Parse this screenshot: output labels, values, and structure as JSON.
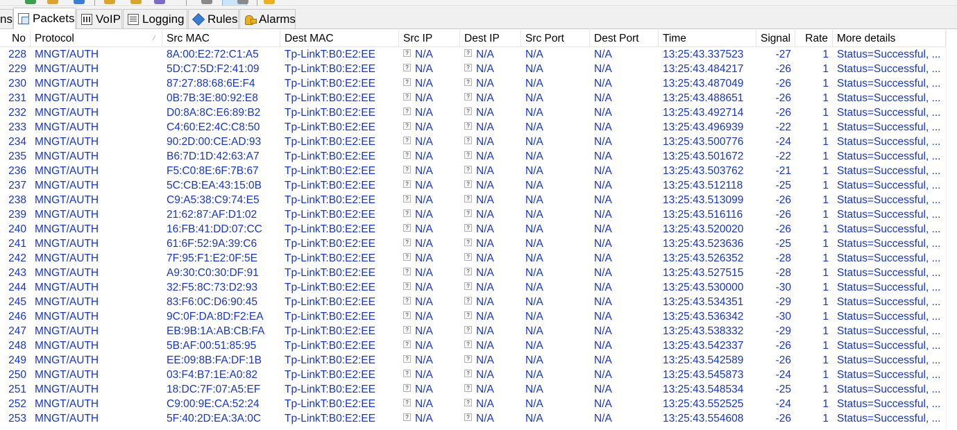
{
  "tabs": [
    {
      "label": "ns",
      "icon": "none",
      "active": false
    },
    {
      "label": "Packets",
      "icon": "packets-icon",
      "active": true
    },
    {
      "label": "VoIP",
      "icon": "voip-icon",
      "active": false
    },
    {
      "label": "Logging",
      "icon": "logging-icon",
      "active": false
    },
    {
      "label": "Rules",
      "icon": "rules-icon",
      "active": false
    },
    {
      "label": "Alarms",
      "icon": "alarms-icon",
      "active": false
    }
  ],
  "columns": {
    "no": "No",
    "protocol": "Protocol",
    "src_mac": "Src MAC",
    "dest_mac": "Dest MAC",
    "src_ip": "Src IP",
    "dest_ip": "Dest IP",
    "src_port": "Src Port",
    "dest_port": "Dest Port",
    "time": "Time",
    "signal": "Signal",
    "rate": "Rate",
    "details": "More details"
  },
  "colors": {
    "row_text": "#1434d4"
  },
  "rows": [
    {
      "no": "228",
      "protocol": "MNGT/AUTH",
      "src_mac": "8A:00:E2:72:C1:A5",
      "dest_mac": "Tp-LinkT:B0:E2:EE",
      "src_ip": "N/A",
      "dest_ip": "N/A",
      "src_port": "N/A",
      "dest_port": "N/A",
      "time": "13:25:43.337523",
      "signal": "-27",
      "rate": "1",
      "details": "Status=Successful, ..."
    },
    {
      "no": "229",
      "protocol": "MNGT/AUTH",
      "src_mac": "5D:C7:5D:F2:41:09",
      "dest_mac": "Tp-LinkT:B0:E2:EE",
      "src_ip": "N/A",
      "dest_ip": "N/A",
      "src_port": "N/A",
      "dest_port": "N/A",
      "time": "13:25:43.484217",
      "signal": "-26",
      "rate": "1",
      "details": "Status=Successful, ..."
    },
    {
      "no": "230",
      "protocol": "MNGT/AUTH",
      "src_mac": "87:27:88:68:6E:F4",
      "dest_mac": "Tp-LinkT:B0:E2:EE",
      "src_ip": "N/A",
      "dest_ip": "N/A",
      "src_port": "N/A",
      "dest_port": "N/A",
      "time": "13:25:43.487049",
      "signal": "-26",
      "rate": "1",
      "details": "Status=Successful, ..."
    },
    {
      "no": "231",
      "protocol": "MNGT/AUTH",
      "src_mac": "0B:7B:3E:80:92:E8",
      "dest_mac": "Tp-LinkT:B0:E2:EE",
      "src_ip": "N/A",
      "dest_ip": "N/A",
      "src_port": "N/A",
      "dest_port": "N/A",
      "time": "13:25:43.488651",
      "signal": "-26",
      "rate": "1",
      "details": "Status=Successful, ..."
    },
    {
      "no": "232",
      "protocol": "MNGT/AUTH",
      "src_mac": "D0:8A:8C:E6:89:B2",
      "dest_mac": "Tp-LinkT:B0:E2:EE",
      "src_ip": "N/A",
      "dest_ip": "N/A",
      "src_port": "N/A",
      "dest_port": "N/A",
      "time": "13:25:43.492714",
      "signal": "-26",
      "rate": "1",
      "details": "Status=Successful, ..."
    },
    {
      "no": "233",
      "protocol": "MNGT/AUTH",
      "src_mac": "C4:60:E2:4C:C8:50",
      "dest_mac": "Tp-LinkT:B0:E2:EE",
      "src_ip": "N/A",
      "dest_ip": "N/A",
      "src_port": "N/A",
      "dest_port": "N/A",
      "time": "13:25:43.496939",
      "signal": "-22",
      "rate": "1",
      "details": "Status=Successful, ..."
    },
    {
      "no": "234",
      "protocol": "MNGT/AUTH",
      "src_mac": "90:2D:00:CE:AD:93",
      "dest_mac": "Tp-LinkT:B0:E2:EE",
      "src_ip": "N/A",
      "dest_ip": "N/A",
      "src_port": "N/A",
      "dest_port": "N/A",
      "time": "13:25:43.500776",
      "signal": "-24",
      "rate": "1",
      "details": "Status=Successful, ..."
    },
    {
      "no": "235",
      "protocol": "MNGT/AUTH",
      "src_mac": "B6:7D:1D:42:63:A7",
      "dest_mac": "Tp-LinkT:B0:E2:EE",
      "src_ip": "N/A",
      "dest_ip": "N/A",
      "src_port": "N/A",
      "dest_port": "N/A",
      "time": "13:25:43.501672",
      "signal": "-22",
      "rate": "1",
      "details": "Status=Successful, ..."
    },
    {
      "no": "236",
      "protocol": "MNGT/AUTH",
      "src_mac": "F5:C0:8E:6F:7B:67",
      "dest_mac": "Tp-LinkT:B0:E2:EE",
      "src_ip": "N/A",
      "dest_ip": "N/A",
      "src_port": "N/A",
      "dest_port": "N/A",
      "time": "13:25:43.503762",
      "signal": "-21",
      "rate": "1",
      "details": "Status=Successful, ..."
    },
    {
      "no": "237",
      "protocol": "MNGT/AUTH",
      "src_mac": "5C:CB:EA:43:15:0B",
      "dest_mac": "Tp-LinkT:B0:E2:EE",
      "src_ip": "N/A",
      "dest_ip": "N/A",
      "src_port": "N/A",
      "dest_port": "N/A",
      "time": "13:25:43.512118",
      "signal": "-25",
      "rate": "1",
      "details": "Status=Successful, ..."
    },
    {
      "no": "238",
      "protocol": "MNGT/AUTH",
      "src_mac": "C9:A5:38:C9:74:E5",
      "dest_mac": "Tp-LinkT:B0:E2:EE",
      "src_ip": "N/A",
      "dest_ip": "N/A",
      "src_port": "N/A",
      "dest_port": "N/A",
      "time": "13:25:43.513099",
      "signal": "-26",
      "rate": "1",
      "details": "Status=Successful, ..."
    },
    {
      "no": "239",
      "protocol": "MNGT/AUTH",
      "src_mac": "21:62:87:AF:D1:02",
      "dest_mac": "Tp-LinkT:B0:E2:EE",
      "src_ip": "N/A",
      "dest_ip": "N/A",
      "src_port": "N/A",
      "dest_port": "N/A",
      "time": "13:25:43.516116",
      "signal": "-26",
      "rate": "1",
      "details": "Status=Successful, ..."
    },
    {
      "no": "240",
      "protocol": "MNGT/AUTH",
      "src_mac": "16:FB:41:DD:07:CC",
      "dest_mac": "Tp-LinkT:B0:E2:EE",
      "src_ip": "N/A",
      "dest_ip": "N/A",
      "src_port": "N/A",
      "dest_port": "N/A",
      "time": "13:25:43.520020",
      "signal": "-26",
      "rate": "1",
      "details": "Status=Successful, ..."
    },
    {
      "no": "241",
      "protocol": "MNGT/AUTH",
      "src_mac": "61:6F:52:9A:39:C6",
      "dest_mac": "Tp-LinkT:B0:E2:EE",
      "src_ip": "N/A",
      "dest_ip": "N/A",
      "src_port": "N/A",
      "dest_port": "N/A",
      "time": "13:25:43.523636",
      "signal": "-25",
      "rate": "1",
      "details": "Status=Successful, ..."
    },
    {
      "no": "242",
      "protocol": "MNGT/AUTH",
      "src_mac": "7F:95:F1:E2:0F:5E",
      "dest_mac": "Tp-LinkT:B0:E2:EE",
      "src_ip": "N/A",
      "dest_ip": "N/A",
      "src_port": "N/A",
      "dest_port": "N/A",
      "time": "13:25:43.526352",
      "signal": "-28",
      "rate": "1",
      "details": "Status=Successful, ..."
    },
    {
      "no": "243",
      "protocol": "MNGT/AUTH",
      "src_mac": "A9:30:C0:30:DF:91",
      "dest_mac": "Tp-LinkT:B0:E2:EE",
      "src_ip": "N/A",
      "dest_ip": "N/A",
      "src_port": "N/A",
      "dest_port": "N/A",
      "time": "13:25:43.527515",
      "signal": "-28",
      "rate": "1",
      "details": "Status=Successful, ..."
    },
    {
      "no": "244",
      "protocol": "MNGT/AUTH",
      "src_mac": "32:F5:8C:73:D2:93",
      "dest_mac": "Tp-LinkT:B0:E2:EE",
      "src_ip": "N/A",
      "dest_ip": "N/A",
      "src_port": "N/A",
      "dest_port": "N/A",
      "time": "13:25:43.530000",
      "signal": "-30",
      "rate": "1",
      "details": "Status=Successful, ..."
    },
    {
      "no": "245",
      "protocol": "MNGT/AUTH",
      "src_mac": "83:F6:0C:D6:90:45",
      "dest_mac": "Tp-LinkT:B0:E2:EE",
      "src_ip": "N/A",
      "dest_ip": "N/A",
      "src_port": "N/A",
      "dest_port": "N/A",
      "time": "13:25:43.534351",
      "signal": "-29",
      "rate": "1",
      "details": "Status=Successful, ..."
    },
    {
      "no": "246",
      "protocol": "MNGT/AUTH",
      "src_mac": "9C:0F:DA:8D:F2:EA",
      "dest_mac": "Tp-LinkT:B0:E2:EE",
      "src_ip": "N/A",
      "dest_ip": "N/A",
      "src_port": "N/A",
      "dest_port": "N/A",
      "time": "13:25:43.536342",
      "signal": "-30",
      "rate": "1",
      "details": "Status=Successful, ..."
    },
    {
      "no": "247",
      "protocol": "MNGT/AUTH",
      "src_mac": "EB:9B:1A:AB:CB:FA",
      "dest_mac": "Tp-LinkT:B0:E2:EE",
      "src_ip": "N/A",
      "dest_ip": "N/A",
      "src_port": "N/A",
      "dest_port": "N/A",
      "time": "13:25:43.538332",
      "signal": "-29",
      "rate": "1",
      "details": "Status=Successful, ..."
    },
    {
      "no": "248",
      "protocol": "MNGT/AUTH",
      "src_mac": "5B:AF:00:51:85:95",
      "dest_mac": "Tp-LinkT:B0:E2:EE",
      "src_ip": "N/A",
      "dest_ip": "N/A",
      "src_port": "N/A",
      "dest_port": "N/A",
      "time": "13:25:43.542337",
      "signal": "-26",
      "rate": "1",
      "details": "Status=Successful, ..."
    },
    {
      "no": "249",
      "protocol": "MNGT/AUTH",
      "src_mac": "EE:09:8B:FA:DF:1B",
      "dest_mac": "Tp-LinkT:B0:E2:EE",
      "src_ip": "N/A",
      "dest_ip": "N/A",
      "src_port": "N/A",
      "dest_port": "N/A",
      "time": "13:25:43.542589",
      "signal": "-26",
      "rate": "1",
      "details": "Status=Successful, ..."
    },
    {
      "no": "250",
      "protocol": "MNGT/AUTH",
      "src_mac": "03:F4:B7:1E:A0:82",
      "dest_mac": "Tp-LinkT:B0:E2:EE",
      "src_ip": "N/A",
      "dest_ip": "N/A",
      "src_port": "N/A",
      "dest_port": "N/A",
      "time": "13:25:43.545873",
      "signal": "-24",
      "rate": "1",
      "details": "Status=Successful, ..."
    },
    {
      "no": "251",
      "protocol": "MNGT/AUTH",
      "src_mac": "18:DC:7F:07:A5:EF",
      "dest_mac": "Tp-LinkT:B0:E2:EE",
      "src_ip": "N/A",
      "dest_ip": "N/A",
      "src_port": "N/A",
      "dest_port": "N/A",
      "time": "13:25:43.548534",
      "signal": "-25",
      "rate": "1",
      "details": "Status=Successful, ..."
    },
    {
      "no": "252",
      "protocol": "MNGT/AUTH",
      "src_mac": "C9:00:9E:CA:52:24",
      "dest_mac": "Tp-LinkT:B0:E2:EE",
      "src_ip": "N/A",
      "dest_ip": "N/A",
      "src_port": "N/A",
      "dest_port": "N/A",
      "time": "13:25:43.552525",
      "signal": "-24",
      "rate": "1",
      "details": "Status=Successful, ..."
    },
    {
      "no": "253",
      "protocol": "MNGT/AUTH",
      "src_mac": "5F:40:2D:EA:3A:0C",
      "dest_mac": "Tp-LinkT:B0:E2:EE",
      "src_ip": "N/A",
      "dest_ip": "N/A",
      "src_port": "N/A",
      "dest_port": "N/A",
      "time": "13:25:43.554608",
      "signal": "-26",
      "rate": "1",
      "details": "Status=Successful, ..."
    }
  ]
}
